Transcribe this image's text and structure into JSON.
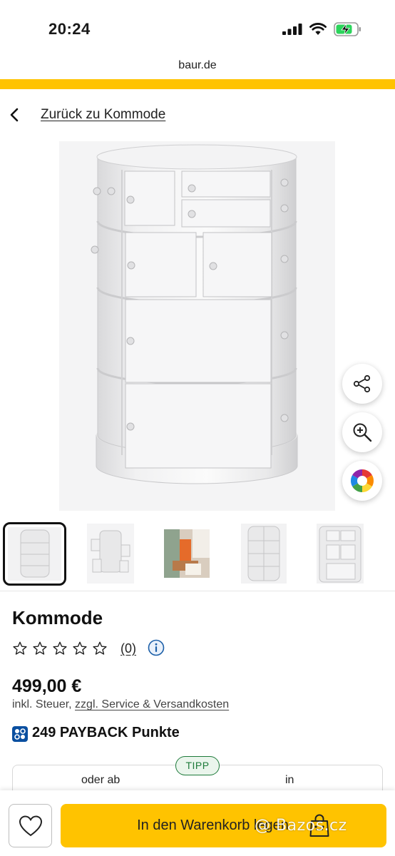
{
  "status_bar": {
    "time": "20:24",
    "url": "baur.de"
  },
  "nav": {
    "back_label": "Zurück zu Kommode"
  },
  "product": {
    "title": "Kommode",
    "rating_stars": 0,
    "rating_max": 5,
    "review_count": "(0)",
    "price": "499,00 €",
    "tax_prefix": "inkl. Steuer, ",
    "tax_link": "zzgl. Service & Versandkosten",
    "payback": "249 PAYBACK Punkte"
  },
  "gallery": {
    "thumbnail_count": 5,
    "selected_index": 0
  },
  "financing": {
    "badge": "TIPP",
    "left_label": "oder ab",
    "right_label": "in"
  },
  "bottom_bar": {
    "cart_label": "In den Warenkorb legen"
  },
  "watermark": "@ Bazos.cz",
  "colors": {
    "accent": "#ffc300",
    "tipp_green": "#1d7a3a",
    "payback_blue": "#0a4fa0"
  },
  "icons": [
    "signal-icon",
    "wifi-icon",
    "battery-icon",
    "back-chevron-icon",
    "share-icon",
    "zoom-icon",
    "color-wheel-icon",
    "star-icon",
    "info-icon",
    "payback-icon",
    "heart-icon",
    "shopping-bag-icon"
  ]
}
